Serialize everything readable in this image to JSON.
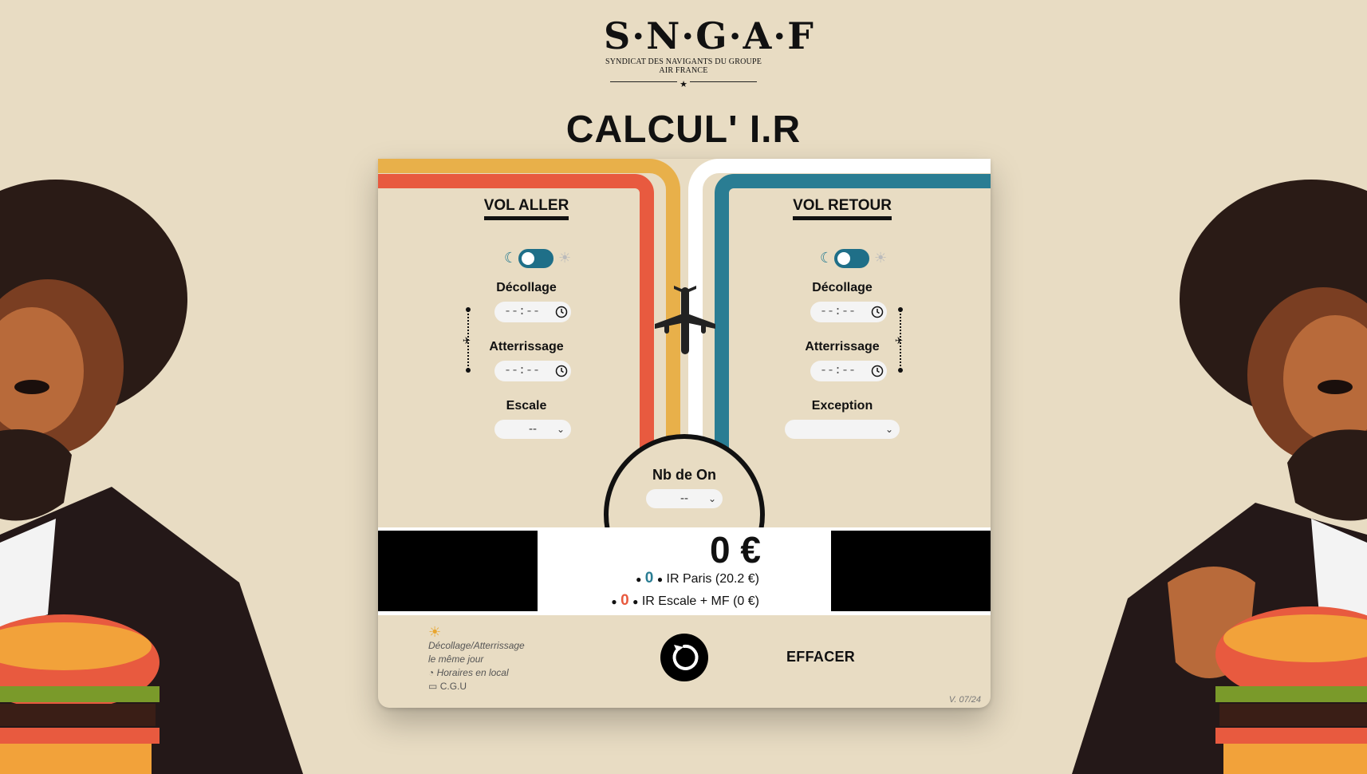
{
  "logo": {
    "letters": "S·N·G·A·F",
    "subtitle": "SYNDICAT DES NAVIGANTS DU GROUPE AIR FRANCE"
  },
  "app_title": "CALCUL' I.R",
  "vol_aller": {
    "title": "VOL ALLER",
    "decollage_label": "Décollage",
    "decollage_value": "--:--",
    "atterrissage_label": "Atterrissage",
    "atterrissage_value": "--:--",
    "escale_label": "Escale",
    "escale_value": "--"
  },
  "vol_retour": {
    "title": "VOL RETOUR",
    "decollage_label": "Décollage",
    "decollage_value": "--:--",
    "atterrissage_label": "Atterrissage",
    "atterrissage_value": "--:--",
    "exception_label": "Exception",
    "exception_value": ""
  },
  "nb_on": {
    "label": "Nb de On",
    "value": "--"
  },
  "result": {
    "total": "0 €",
    "ir_paris_value": "0",
    "ir_paris_label": "IR Paris (20.2 €)",
    "ir_escale_value": "0",
    "ir_escale_label": "IR Escale + MF (0 €)"
  },
  "footer": {
    "note_line1": "Décollage/Atterrissage",
    "note_line2": "le même jour",
    "horaires": "Horaires en local",
    "cgu": "C.G.U",
    "effacer": "EFFACER",
    "version": "V. 07/24"
  },
  "colors": {
    "background": "#e8dcc3",
    "stripe_yellow": "#e8b04a",
    "stripe_orange": "#e85a3f",
    "stripe_teal": "#2a7d93",
    "stripe_white": "#ffffff",
    "toggle": "#1f6f88"
  }
}
